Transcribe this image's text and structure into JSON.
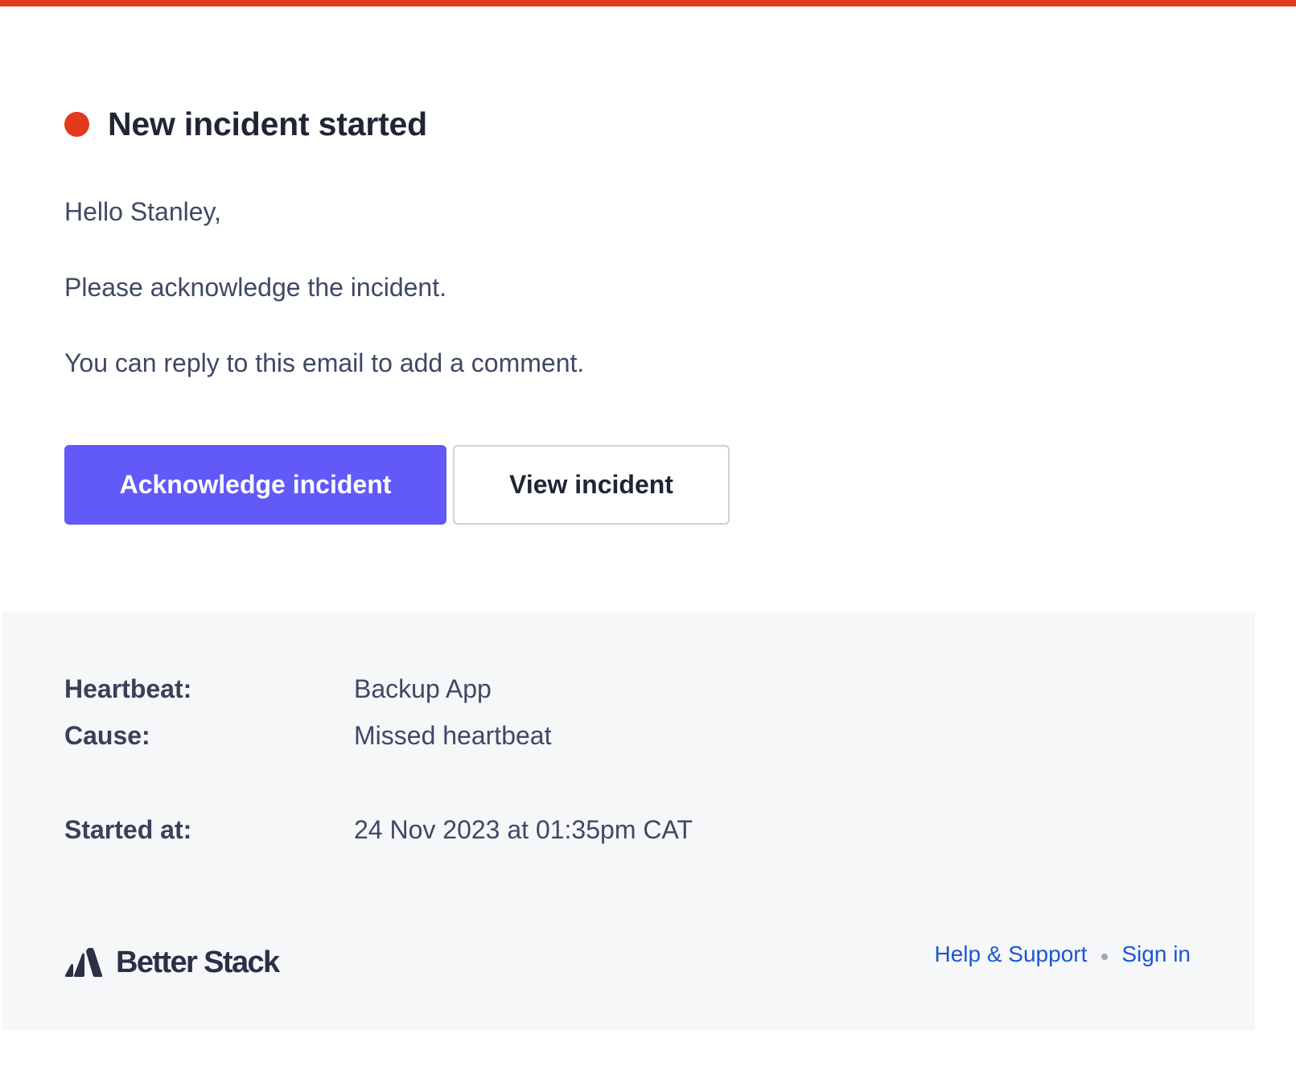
{
  "header": {
    "title": "New incident started",
    "status_color": "#e3391c"
  },
  "message": {
    "greeting": "Hello Stanley,",
    "paragraphs": [
      "Please acknowledge the incident.",
      "You can reply to this email to add a comment."
    ]
  },
  "actions": {
    "acknowledge_label": "Acknowledge incident",
    "view_label": "View incident",
    "primary_color": "#6159f8"
  },
  "details": [
    {
      "label": "Heartbeat:",
      "value": "Backup App"
    },
    {
      "label": "Cause:",
      "value": "Missed heartbeat"
    },
    {
      "label": "Started at:",
      "value": "24 Nov 2023 at 01:35pm CAT"
    }
  ],
  "footer": {
    "brand": "Better Stack",
    "logo_icon": "better-stack-logo-icon",
    "links": [
      {
        "label": "Help & Support"
      },
      {
        "label": "Sign in"
      }
    ],
    "link_color": "#1a56d6"
  }
}
